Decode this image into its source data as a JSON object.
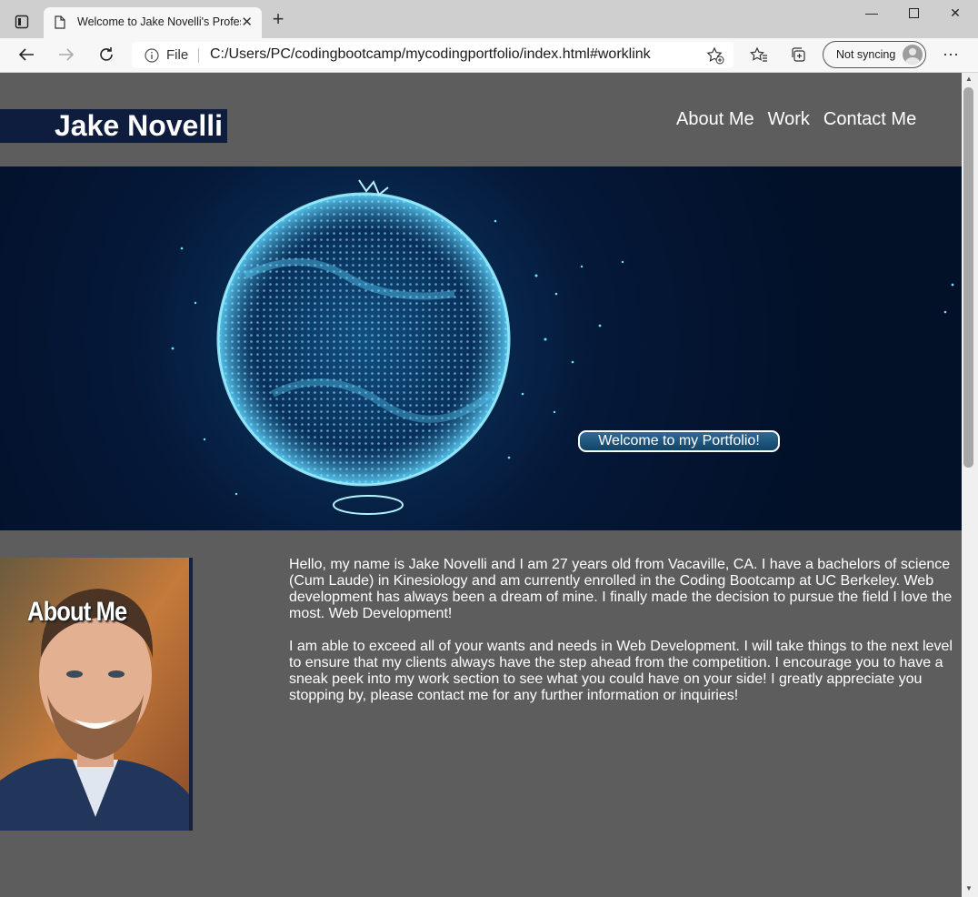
{
  "browser": {
    "tab_title": "Welcome to Jake Novelli's Professional Portfolio",
    "file_label": "File",
    "url": "C:/Users/PC/codingbootcamp/mycodingportfolio/index.html#worklink",
    "sync_label": "Not syncing"
  },
  "header": {
    "brand_name": "Jake Novelli",
    "nav": [
      "About Me",
      "Work",
      "Contact Me"
    ]
  },
  "hero": {
    "button_label": "Welcome to my Portfolio!"
  },
  "about": {
    "heading": "About Me",
    "paragraphs": [
      "Hello, my name is Jake Novelli and I am 27 years old from Vacaville, CA. I have a bachelors of science (Cum Laude) in Kinesiology and am currently enrolled in the Coding Bootcamp at UC Berkeley. Web development has always been a dream of mine. I finally made the decision to pursue the field I love the most. Web Development!",
      "I am able to exceed all of your wants and needs in Web Development. I will take things to the next level to ensure that my clients always have the step ahead from the competition. I encourage you to have a sneak peek into my work section to see what you could have on your side! I greatly appreciate you stopping by, please contact me for any further information or inquiries!"
    ]
  },
  "colors": {
    "page_bg": "#5d5d5d",
    "brand_bg": "#0e1d3e",
    "hero_bg": "#051838",
    "globe_glow": "#6fe0ff"
  }
}
